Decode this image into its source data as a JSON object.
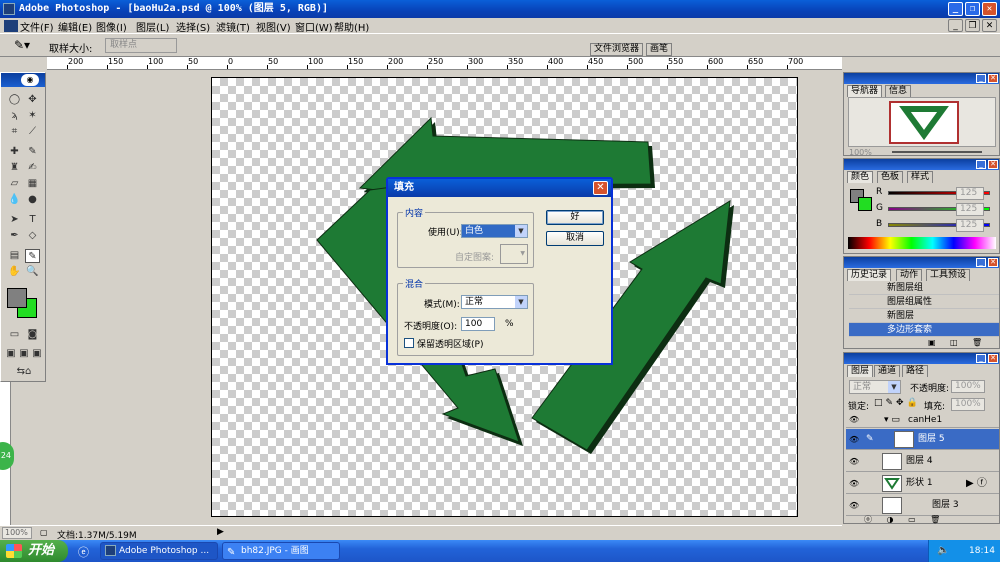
{
  "window": {
    "title": "Adobe Photoshop - [baoHu2a.psd @ 100% (图层 5, RGB)]"
  },
  "menu": [
    "文件(F)",
    "编辑(E)",
    "图像(I)",
    "图层(L)",
    "选择(S)",
    "滤镜(T)",
    "视图(V)",
    "窗口(W)",
    "帮助(H)"
  ],
  "options": {
    "sample_label": "取样大小:",
    "sample_value": "取样点"
  },
  "dock_tabs": [
    "文件浏览器",
    "画笔"
  ],
  "ruler": [
    "200",
    "150",
    "100",
    "50",
    "0",
    "50",
    "100",
    "150",
    "200",
    "250",
    "300",
    "350",
    "400",
    "450",
    "500",
    "550",
    "600",
    "650",
    "700"
  ],
  "status": {
    "zoom": "100%",
    "doc": "文档:1.37M/5.19M"
  },
  "taskbar": {
    "start": "开始",
    "tasks": [
      "Adobe Photoshop ...",
      "bh82.JPG - 画图"
    ],
    "clock": "18:14"
  },
  "navigator": {
    "tabs": [
      "导航器",
      "信息"
    ],
    "zoom": "100%"
  },
  "color": {
    "tabs": [
      "颜色",
      "色板",
      "样式"
    ],
    "channels": [
      {
        "label": "R",
        "value": "125"
      },
      {
        "label": "G",
        "value": "125"
      },
      {
        "label": "B",
        "value": "125"
      }
    ],
    "fg": "#808080",
    "bg": "#22dd22"
  },
  "history": {
    "tabs": [
      "历史记录",
      "动作",
      "工具预设"
    ],
    "items": [
      "新图层组",
      "图层组属性",
      "新图层",
      "多边形套索"
    ]
  },
  "layers": {
    "tabs": [
      "图层",
      "通道",
      "路径"
    ],
    "blend": "正常",
    "opacity_label": "不透明度:",
    "opacity": "100%",
    "lock_label": "锁定:",
    "fill_label": "填充:",
    "fill": "100%",
    "group": "canHe1",
    "rows": [
      "图层 5",
      "图层 4",
      "形状 1",
      "图层 3"
    ]
  },
  "dialog": {
    "title": "填充",
    "content_group": "内容",
    "use_label": "使用(U):",
    "use_value": "白色",
    "pattern_label": "自定图案:",
    "blend_group": "混合",
    "mode_label": "模式(M):",
    "mode_value": "正常",
    "opacity_label": "不透明度(O):",
    "opacity_value": "100",
    "opacity_unit": "%",
    "preserve_label": "保留透明区域(P)",
    "ok": "好",
    "cancel": "取消"
  },
  "colors": {
    "arrow": "#1e7a34",
    "arrow_shadow": "#0d2e12"
  }
}
